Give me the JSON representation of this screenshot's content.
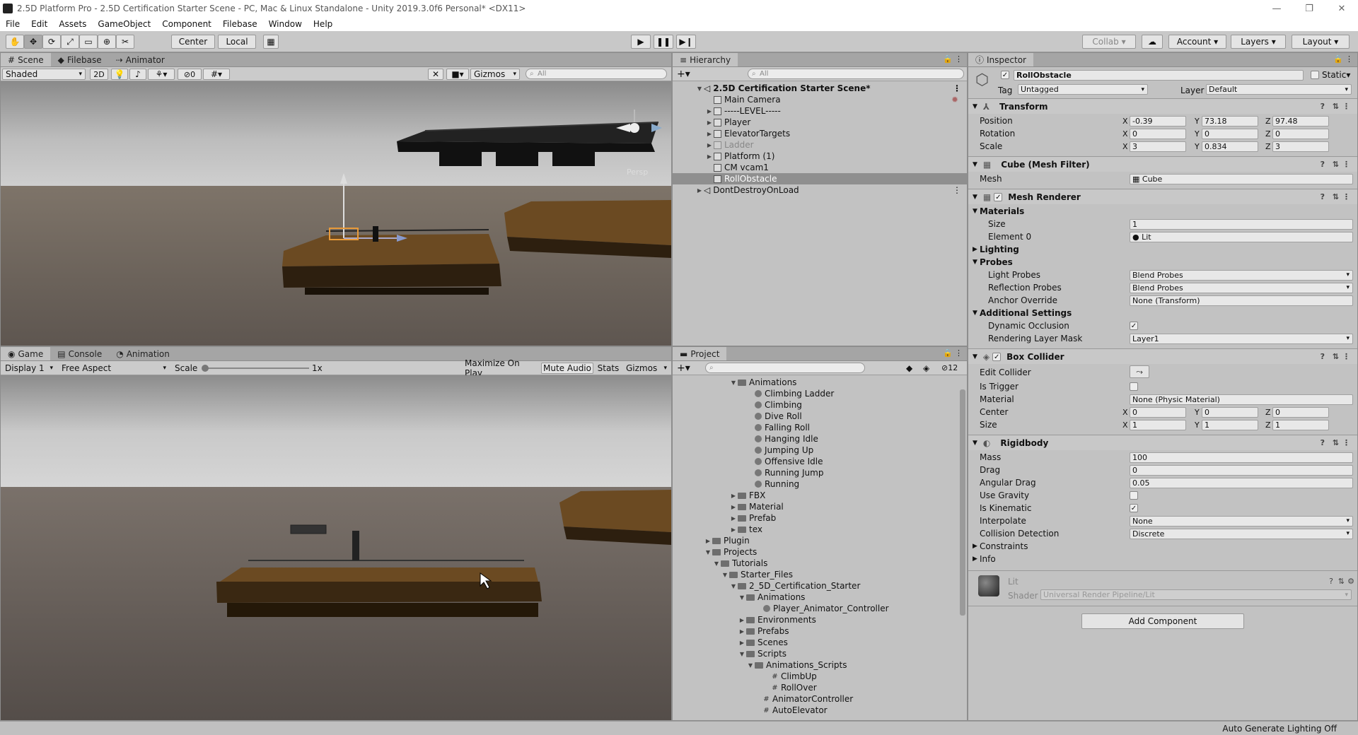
{
  "window": {
    "title": "2.5D Platform Pro - 2.5D Certification Starter Scene - PC, Mac & Linux Standalone - Unity 2019.3.0f6 Personal* <DX11>"
  },
  "menu": [
    "File",
    "Edit",
    "Assets",
    "GameObject",
    "Component",
    "Filebase",
    "Window",
    "Help"
  ],
  "toolbar": {
    "center": "Center",
    "local": "Local",
    "collab": "Collab",
    "account": "Account",
    "layers": "Layers",
    "layout": "Layout"
  },
  "scene": {
    "tabs": [
      "Scene",
      "Filebase",
      "Animator"
    ],
    "shading": "Shaded",
    "mode2d": "2D",
    "fx_count": "0",
    "gizmos": "Gizmos",
    "search": "All",
    "persp": "Persp"
  },
  "game": {
    "tabs": [
      "Game",
      "Console",
      "Animation"
    ],
    "display": "Display 1",
    "aspect": "Free Aspect",
    "scale_label": "Scale",
    "scale_value": "1x",
    "maximize": "Maximize On Play",
    "mute": "Mute Audio",
    "stats": "Stats",
    "gizmos": "Gizmos"
  },
  "hierarchy": {
    "tab": "Hierarchy",
    "search": "All",
    "scene": "2.5D Certification Starter Scene*",
    "items": [
      "Main Camera",
      "-----LEVEL-----",
      "Player",
      "ElevatorTargets",
      "Ladder",
      "Platform (1)",
      "CM vcam1",
      "RollObstacle"
    ],
    "dontdestroy": "DontDestroyOnLoad"
  },
  "project": {
    "tab": "Project",
    "count": "12",
    "tree": [
      {
        "label": "Animations",
        "indent": 5,
        "type": "folder",
        "arrow": "▼"
      },
      {
        "label": "Climbing Ladder",
        "indent": 7,
        "type": "anim"
      },
      {
        "label": "Climbing",
        "indent": 7,
        "type": "anim"
      },
      {
        "label": "Dive Roll",
        "indent": 7,
        "type": "anim"
      },
      {
        "label": "Falling Roll",
        "indent": 7,
        "type": "anim"
      },
      {
        "label": "Hanging Idle",
        "indent": 7,
        "type": "anim"
      },
      {
        "label": "Jumping Up",
        "indent": 7,
        "type": "anim"
      },
      {
        "label": "Offensive Idle",
        "indent": 7,
        "type": "anim"
      },
      {
        "label": "Running Jump",
        "indent": 7,
        "type": "anim"
      },
      {
        "label": "Running",
        "indent": 7,
        "type": "anim"
      },
      {
        "label": "FBX",
        "indent": 5,
        "type": "folder",
        "arrow": "▶"
      },
      {
        "label": "Material",
        "indent": 5,
        "type": "folder",
        "arrow": "▶"
      },
      {
        "label": "Prefab",
        "indent": 5,
        "type": "folder",
        "arrow": "▶"
      },
      {
        "label": "tex",
        "indent": 5,
        "type": "folder",
        "arrow": "▶"
      },
      {
        "label": "Plugin",
        "indent": 2,
        "type": "folder",
        "arrow": "▶"
      },
      {
        "label": "Projects",
        "indent": 2,
        "type": "folder",
        "arrow": "▼"
      },
      {
        "label": "Tutorials",
        "indent": 3,
        "type": "folder",
        "arrow": "▼"
      },
      {
        "label": "Starter_Files",
        "indent": 4,
        "type": "folder",
        "arrow": "▼"
      },
      {
        "label": "2_5D_Certification_Starter",
        "indent": 5,
        "type": "folder",
        "arrow": "▼"
      },
      {
        "label": "Animations",
        "indent": 6,
        "type": "folder",
        "arrow": "▼"
      },
      {
        "label": "Player_Animator_Controller",
        "indent": 8,
        "type": "anim"
      },
      {
        "label": "Environments",
        "indent": 6,
        "type": "folder",
        "arrow": "▶"
      },
      {
        "label": "Prefabs",
        "indent": 6,
        "type": "folder",
        "arrow": "▶"
      },
      {
        "label": "Scenes",
        "indent": 6,
        "type": "folder",
        "arrow": "▶"
      },
      {
        "label": "Scripts",
        "indent": 6,
        "type": "folder",
        "arrow": "▼"
      },
      {
        "label": "Animations_Scripts",
        "indent": 7,
        "type": "folder",
        "arrow": "▼"
      },
      {
        "label": "ClimbUp",
        "indent": 9,
        "type": "script"
      },
      {
        "label": "RollOver",
        "indent": 9,
        "type": "script"
      },
      {
        "label": "AnimatorController",
        "indent": 8,
        "type": "script"
      },
      {
        "label": "AutoElevator",
        "indent": 8,
        "type": "script"
      }
    ]
  },
  "inspector": {
    "tab": "Inspector",
    "object_name": "RollObstacle",
    "static": "Static",
    "tag_label": "Tag",
    "tag": "Untagged",
    "layer_label": "Layer",
    "layer": "Default",
    "transform": {
      "title": "Transform",
      "position_label": "Position",
      "rotation_label": "Rotation",
      "scale_label": "Scale",
      "position": [
        "-0.39",
        "73.18",
        "97.48"
      ],
      "rotation": [
        "0",
        "0",
        "0"
      ],
      "scale": [
        "3",
        "0.834",
        "3"
      ]
    },
    "mesh_filter": {
      "title": "Cube (Mesh Filter)",
      "mesh_label": "Mesh",
      "mesh": "Cube"
    },
    "mesh_renderer": {
      "title": "Mesh Renderer",
      "materials": "Materials",
      "size_label": "Size",
      "size": "1",
      "element_label": "Element 0",
      "element": "Lit",
      "lighting": "Lighting",
      "probes": "Probes",
      "light_probes_label": "Light Probes",
      "light_probes": "Blend Probes",
      "reflection_label": "Reflection Probes",
      "reflection": "Blend Probes",
      "anchor_label": "Anchor Override",
      "anchor": "None (Transform)",
      "additional": "Additional Settings",
      "dynamic_label": "Dynamic Occlusion",
      "mask_label": "Rendering Layer Mask",
      "mask": "Layer1"
    },
    "box_collider": {
      "title": "Box Collider",
      "edit_label": "Edit Collider",
      "trigger_label": "Is Trigger",
      "material_label": "Material",
      "material": "None (Physic Material)",
      "center_label": "Center",
      "center": [
        "0",
        "0",
        "0"
      ],
      "size_label": "Size",
      "size": [
        "1",
        "1",
        "1"
      ]
    },
    "rigidbody": {
      "title": "Rigidbody",
      "mass_label": "Mass",
      "mass": "100",
      "drag_label": "Drag",
      "drag": "0",
      "angular_label": "Angular Drag",
      "angular": "0.05",
      "gravity_label": "Use Gravity",
      "kinematic_label": "Is Kinematic",
      "interpolate_label": "Interpolate",
      "interpolate": "None",
      "collision_label": "Collision Detection",
      "collision": "Discrete",
      "constraints": "Constraints",
      "info": "Info"
    },
    "material": {
      "name": "Lit",
      "shader_label": "Shader",
      "shader": "Universal Render Pipeline/Lit"
    },
    "add_component": "Add Component"
  },
  "status": {
    "lighting": "Auto Generate Lighting Off"
  }
}
